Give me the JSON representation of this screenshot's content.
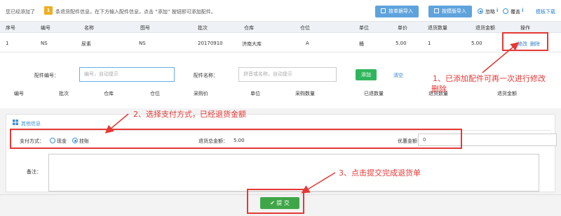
{
  "toolbar": {
    "notice_prefix": "您已经添加了",
    "count": "1",
    "notice_suffix": "条退货配件信息，在下方输入配件信息，点击 “添加” 按钮即可添加配件。",
    "import_by_order": "按单据导入",
    "import_by_template": "按模版导入",
    "option_skip": "忽略",
    "option_overwrite": "覆盖",
    "template_download": "模板下载"
  },
  "table": {
    "headers": [
      "序号",
      "编号",
      "名称",
      "图号",
      "批次",
      "仓库",
      "仓位",
      "单位",
      "单价",
      "退货数量",
      "退货金额",
      "操作"
    ],
    "rows": [
      {
        "cells": [
          "1",
          "NS",
          "尿素",
          "NS",
          "20170910",
          "济南大库",
          "A",
          "桶",
          "5.00",
          "1",
          "5.00"
        ],
        "edit": "修改",
        "delete": "删除"
      }
    ]
  },
  "add_form": {
    "part_no_label": "配件编号：",
    "part_no_placeholder": "编号，自动提示",
    "part_name_label": "配件名称：",
    "part_name_placeholder": "拼音或名称，自动提示",
    "add_button": "添加",
    "clear_button": "清空"
  },
  "sub_table": {
    "headers": [
      "编号",
      "批次",
      "仓库",
      "仓位",
      "采购价",
      "单位",
      "采购数量",
      "已退数量",
      "退货数量",
      "退货金额"
    ]
  },
  "other_info": {
    "title": "其他信息",
    "payment_label": "支付方式：",
    "payment_cash": "现金",
    "payment_credit": "挂账",
    "total_label": "退货总金额：",
    "total_value": "5.00",
    "discount_label": "优惠金额：",
    "discount_value": "0",
    "remark_label": "备注："
  },
  "submit": {
    "label": "提 交"
  },
  "annotations": {
    "note1_line1": "1、已添加配件可再一次进行修改",
    "note1_line2": "删除",
    "note2": "2、选择支付方式，已经退货金额",
    "note3": "3、点击提交完成退货单"
  },
  "colors": {
    "accent": "#5fa3dc",
    "annotation": "#e53935",
    "success": "#3fa648"
  }
}
